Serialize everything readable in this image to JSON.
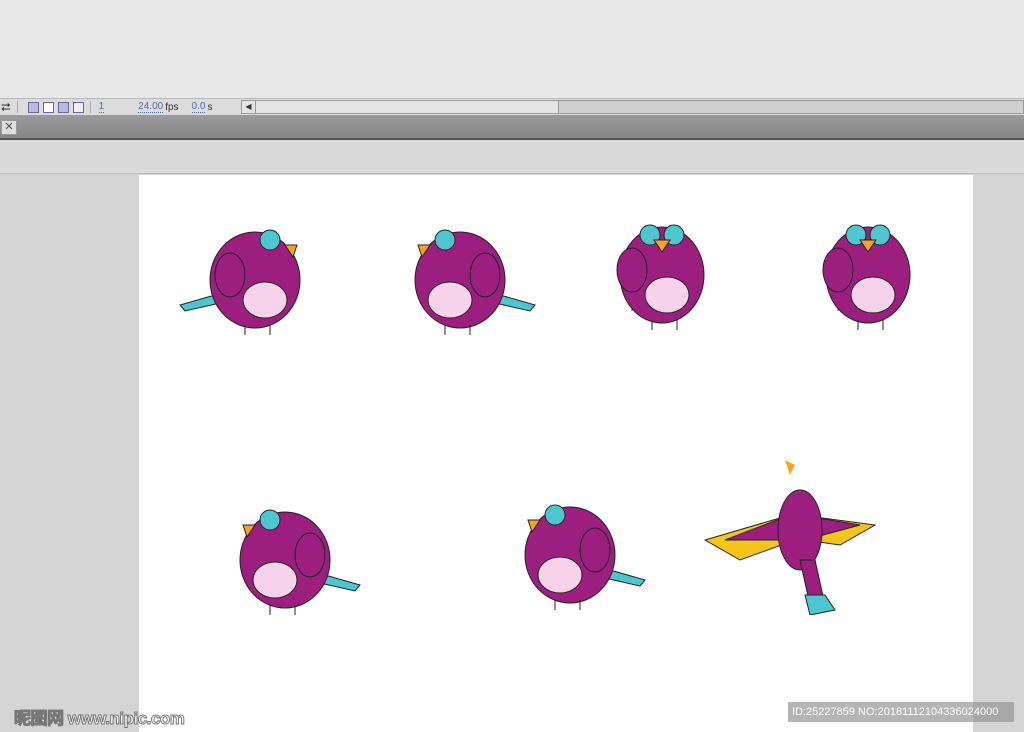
{
  "timeline": {
    "frame": "1",
    "fps": "24.00",
    "fps_unit": "fps",
    "time": "0.0",
    "time_unit": "s"
  },
  "watermark": {
    "logo": "昵图网 www.nipic.com",
    "id_text": "ID:25227859 NO:20181112104336024000"
  },
  "colors": {
    "body": "#9c1f80",
    "belly": "#f6d3ea",
    "eye": "#4ec6cf",
    "beak": "#f4a51f",
    "wing_tip": "#f6c51a",
    "tail": "#4ec6cf"
  },
  "birds": [
    "bird-facing-right",
    "bird-facing-left",
    "bird-front",
    "bird-saluting",
    "bird-crouching",
    "bird-diving",
    "bird-flying"
  ]
}
